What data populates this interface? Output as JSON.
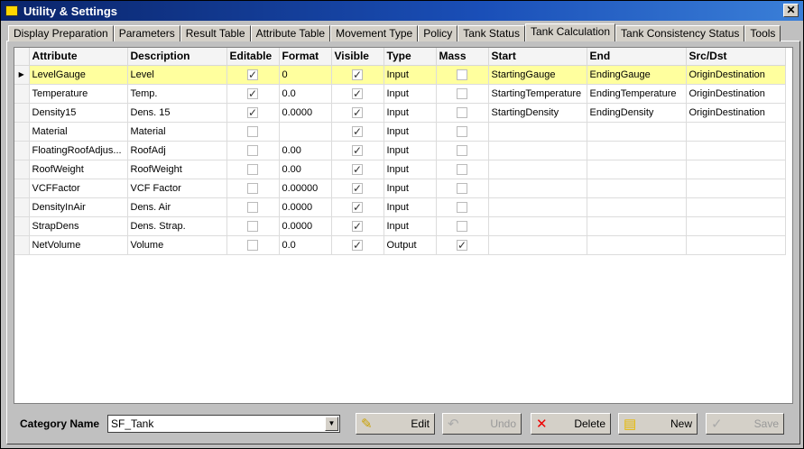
{
  "window": {
    "title": "Utility & Settings",
    "close": "✕"
  },
  "tabs": [
    "Display Preparation",
    "Parameters",
    "Result Table",
    "Attribute Table",
    "Movement Type",
    "Policy",
    "Tank Status",
    "Tank Calculation",
    "Tank Consistency Status",
    "Tools"
  ],
  "active_tab": "Tank Calculation",
  "columns": [
    "Attribute",
    "Description",
    "Editable",
    "Format",
    "Visible",
    "Type",
    "Mass",
    "Start",
    "End",
    "Src/Dst"
  ],
  "rows": [
    {
      "attribute": "LevelGauge",
      "description": "Level",
      "editable": true,
      "format": "0",
      "visible": true,
      "type": "Input",
      "mass": false,
      "start": "StartingGauge",
      "end": "EndingGauge",
      "srcdst": "OriginDestination"
    },
    {
      "attribute": "Temperature",
      "description": "Temp.",
      "editable": true,
      "format": "0.0",
      "visible": true,
      "type": "Input",
      "mass": false,
      "start": "StartingTemperature",
      "end": "EndingTemperature",
      "srcdst": "OriginDestination"
    },
    {
      "attribute": "Density15",
      "description": "Dens. 15",
      "editable": true,
      "format": "0.0000",
      "visible": true,
      "type": "Input",
      "mass": false,
      "start": "StartingDensity",
      "end": "EndingDensity",
      "srcdst": "OriginDestination"
    },
    {
      "attribute": "Material",
      "description": "Material",
      "editable": false,
      "format": "",
      "visible": true,
      "type": "Input",
      "mass": false,
      "start": "",
      "end": "",
      "srcdst": ""
    },
    {
      "attribute": "FloatingRoofAdjus...",
      "description": "RoofAdj",
      "editable": false,
      "format": "0.00",
      "visible": true,
      "type": "Input",
      "mass": false,
      "start": "",
      "end": "",
      "srcdst": ""
    },
    {
      "attribute": "RoofWeight",
      "description": "RoofWeight",
      "editable": false,
      "format": "0.00",
      "visible": true,
      "type": "Input",
      "mass": false,
      "start": "",
      "end": "",
      "srcdst": ""
    },
    {
      "attribute": "VCFFactor",
      "description": "VCF Factor",
      "editable": false,
      "format": "0.00000",
      "visible": true,
      "type": "Input",
      "mass": false,
      "start": "",
      "end": "",
      "srcdst": ""
    },
    {
      "attribute": "DensityInAir",
      "description": "Dens. Air",
      "editable": false,
      "format": "0.0000",
      "visible": true,
      "type": "Input",
      "mass": false,
      "start": "",
      "end": "",
      "srcdst": ""
    },
    {
      "attribute": "StrapDens",
      "description": "Dens. Strap.",
      "editable": false,
      "format": "0.0000",
      "visible": true,
      "type": "Input",
      "mass": false,
      "start": "",
      "end": "",
      "srcdst": ""
    },
    {
      "attribute": "NetVolume",
      "description": "Volume",
      "editable": false,
      "format": "0.0",
      "visible": true,
      "type": "Output",
      "mass": true,
      "start": "",
      "end": "",
      "srcdst": ""
    }
  ],
  "selected_row": 0,
  "footer": {
    "category_label": "Category Name",
    "category_value": "SF_Tank",
    "buttons": [
      {
        "label": "Edit",
        "icon": "pencil-icon",
        "enabled": true
      },
      {
        "label": "Undo",
        "icon": "undo-icon",
        "enabled": false
      },
      {
        "label": "Delete",
        "icon": "x-icon",
        "enabled": true
      },
      {
        "label": "New",
        "icon": "new-document-icon",
        "enabled": true
      },
      {
        "label": "Save",
        "icon": "check-icon",
        "enabled": false
      }
    ]
  }
}
